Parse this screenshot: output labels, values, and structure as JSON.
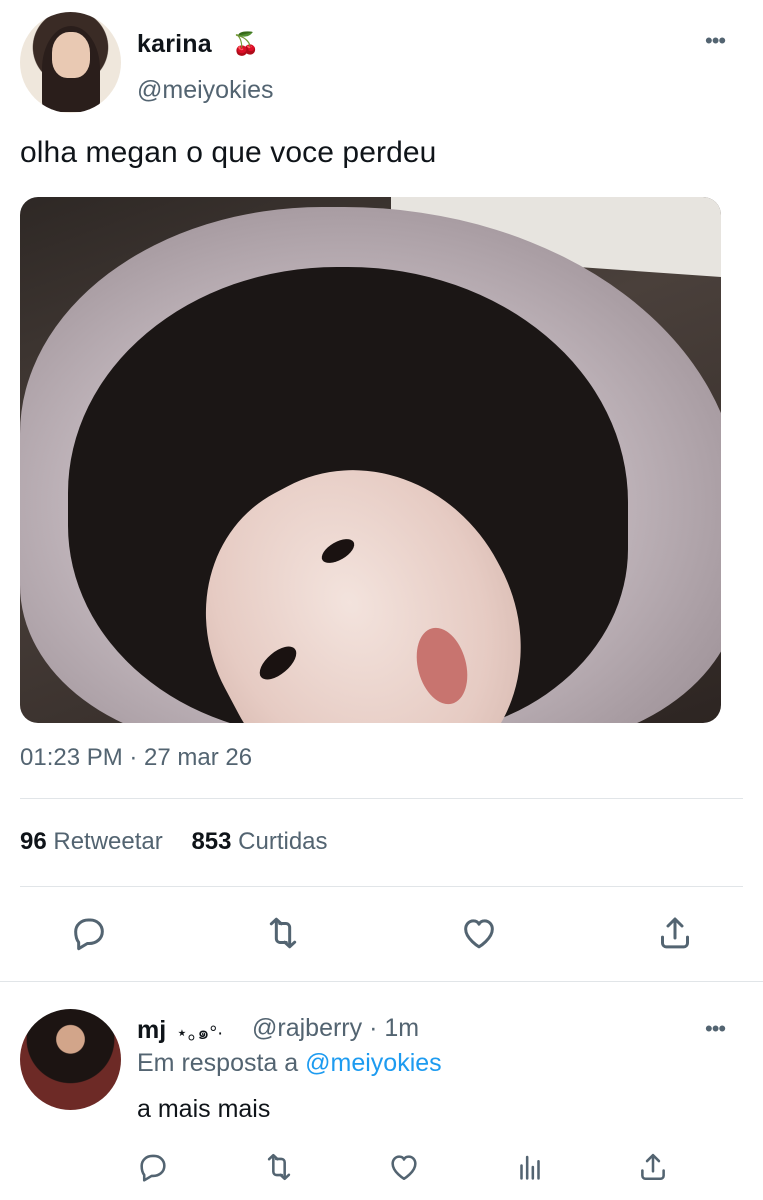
{
  "tweet": {
    "author_name": "karina",
    "author_emoji": "🍒",
    "author_handle": "@meiyokies",
    "more_label": "•••",
    "text": "olha megan o que voce perdeu",
    "timestamp": "01:23 PM · 27 mar 26",
    "stats": {
      "retweets_count": "96",
      "retweets_label": "Retweetar",
      "likes_count": "853",
      "likes_label": "Curtidas"
    },
    "actions": [
      {
        "icon": "reply-icon"
      },
      {
        "icon": "retweet-icon"
      },
      {
        "icon": "like-icon"
      },
      {
        "icon": "share-icon"
      }
    ]
  },
  "reply": {
    "author_name": "mj",
    "author_decoration": "⋆｡๑°·",
    "meta": "@rajberry · 1m",
    "more_label": "•••",
    "reply_to_prefix": "Em resposta a",
    "reply_to_handle": "@meiyokies",
    "text": "a mais mais",
    "actions": [
      {
        "icon": "reply-icon"
      },
      {
        "icon": "retweet-icon"
      },
      {
        "icon": "like-icon"
      },
      {
        "icon": "views-icon"
      },
      {
        "icon": "share-icon"
      }
    ]
  },
  "colors": {
    "text_primary": "#0f1419",
    "text_secondary": "#536471",
    "link": "#1d9bf0",
    "divider": "#e1e5e8"
  }
}
